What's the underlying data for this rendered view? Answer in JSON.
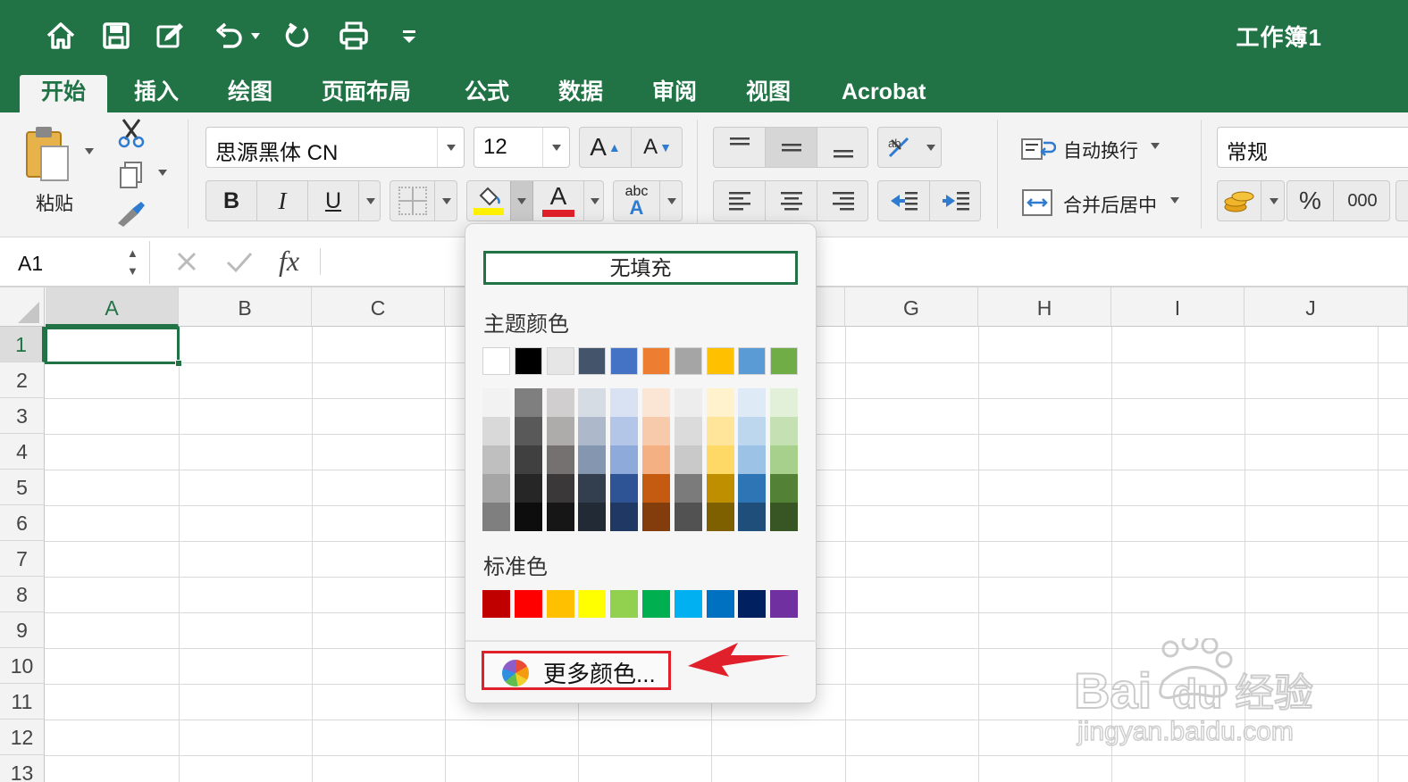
{
  "titlebar": {
    "doc_title": "工作簿1",
    "quick_access": [
      "home-icon",
      "save-icon",
      "edit-icon",
      "undo-icon",
      "redo-icon",
      "print-icon",
      "customize-icon"
    ]
  },
  "tabs": {
    "items": [
      "开始",
      "插入",
      "绘图",
      "页面布局",
      "公式",
      "数据",
      "审阅",
      "视图",
      "Acrobat"
    ],
    "active": "开始"
  },
  "ribbon": {
    "paste_label": "粘贴",
    "font_name": "思源黑体 CN",
    "font_size": "12",
    "grow_font": "A",
    "shrink_font": "A",
    "bold": "B",
    "italic": "I",
    "underline": "U",
    "font_color": "A",
    "phonetic": "abc",
    "phonetic_sub": "A",
    "wrap_text": "自动换行",
    "merge_center": "合并后居中",
    "number_format": "常规",
    "percent": "%",
    "thousands": "000",
    "colors": {
      "fill_bar": "#FFF200",
      "font_bar": "#E0202A"
    }
  },
  "formula_bar": {
    "name_box": "A1",
    "fx": "fx",
    "content": ""
  },
  "grid": {
    "columns_left": [
      "A",
      "B",
      "C"
    ],
    "columns_right": [
      "G",
      "H",
      "I",
      "J"
    ],
    "rows": [
      "1",
      "2",
      "3",
      "4",
      "5",
      "6",
      "7",
      "8",
      "9",
      "10",
      "11",
      "12",
      "13"
    ],
    "selected_cell": "A1"
  },
  "fill_popup": {
    "no_fill": "无填充",
    "theme_title": "主题颜色",
    "theme_colors": [
      "#FFFFFF",
      "#000000",
      "#E7E6E6",
      "#44546A",
      "#4472C4",
      "#ED7D31",
      "#A5A5A5",
      "#FFC000",
      "#5B9BD5",
      "#70AD47"
    ],
    "theme_shades": [
      [
        "#F2F2F2",
        "#D9D9D9",
        "#BFBFBF",
        "#A6A6A6",
        "#7F7F7F"
      ],
      [
        "#7F7F7F",
        "#595959",
        "#404040",
        "#262626",
        "#0D0D0D"
      ],
      [
        "#D0CECE",
        "#AEABAB",
        "#757171",
        "#3A3838",
        "#161616"
      ],
      [
        "#D6DCE4",
        "#ADB9CA",
        "#8496B0",
        "#333F4F",
        "#222A35"
      ],
      [
        "#D9E2F3",
        "#B4C6E7",
        "#8EAADB",
        "#2F5496",
        "#1F3864"
      ],
      [
        "#FBE5D5",
        "#F7CAAC",
        "#F4B083",
        "#C55A11",
        "#833C0B"
      ],
      [
        "#EDEDED",
        "#DBDBDB",
        "#C9C9C9",
        "#7B7B7B",
        "#525252"
      ],
      [
        "#FFF2CC",
        "#FFE599",
        "#FFD966",
        "#BF8F00",
        "#7F6000"
      ],
      [
        "#DEEBF6",
        "#BDD7EE",
        "#9CC3E5",
        "#2E75B5",
        "#1E4E79"
      ],
      [
        "#E2EFD9",
        "#C5E0B3",
        "#A8D08D",
        "#538135",
        "#375623"
      ]
    ],
    "standard_title": "标准色",
    "standard_colors": [
      "#C00000",
      "#FF0000",
      "#FFC000",
      "#FFFF00",
      "#92D050",
      "#00B050",
      "#00B0F0",
      "#0070C0",
      "#002060",
      "#7030A0"
    ],
    "more_colors": "更多颜色...",
    "highlight_color": "#E0202A"
  },
  "watermark": {
    "line1": "Bai",
    "line1b": "du",
    "line1c": "经验",
    "line2": "jingyan.baidu.com"
  }
}
